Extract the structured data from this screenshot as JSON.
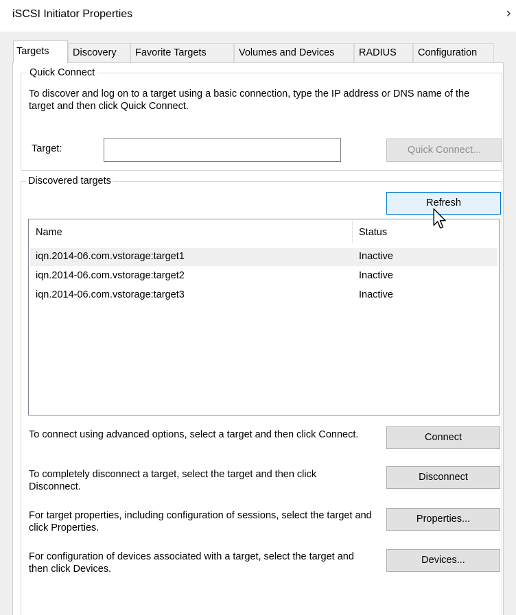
{
  "window": {
    "title": "iSCSI Initiator Properties",
    "close_glyph": "›"
  },
  "tabs": [
    {
      "label": "Targets",
      "active": true
    },
    {
      "label": "Discovery"
    },
    {
      "label": "Favorite Targets"
    },
    {
      "label": "Volumes and Devices"
    },
    {
      "label": "RADIUS"
    },
    {
      "label": "Configuration"
    }
  ],
  "quick_connect": {
    "legend": "Quick Connect",
    "description": "To discover and log on to a target using a basic connection, type the IP address or DNS name of the target and then click Quick Connect.",
    "target_label": "Target:",
    "target_value": "",
    "button": "Quick Connect..."
  },
  "discovered": {
    "legend": "Discovered targets",
    "refresh_button": "Refresh",
    "columns": [
      "Name",
      "Status"
    ],
    "rows": [
      {
        "name": "iqn.2014-06.com.vstorage:target1",
        "status": "Inactive"
      },
      {
        "name": "iqn.2014-06.com.vstorage:target2",
        "status": "Inactive"
      },
      {
        "name": "iqn.2014-06.com.vstorage:target3",
        "status": "Inactive"
      }
    ]
  },
  "actions": [
    {
      "text": "To connect using advanced options, select a target and then click Connect.",
      "button": "Connect"
    },
    {
      "text": "To completely disconnect a target, select the target and then click Disconnect.",
      "button": "Disconnect"
    },
    {
      "text": "For target properties, including configuration of sessions, select the target and click Properties.",
      "button": "Properties..."
    },
    {
      "text": "For configuration of devices associated with a target, select the target and then click Devices.",
      "button": "Devices..."
    }
  ]
}
